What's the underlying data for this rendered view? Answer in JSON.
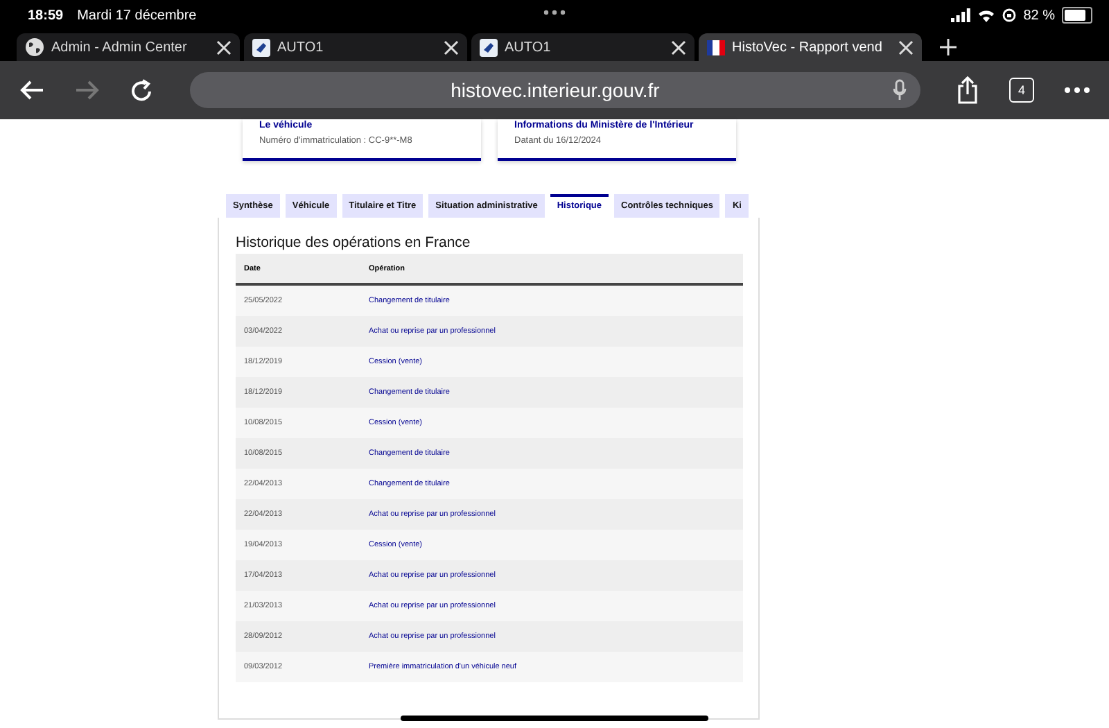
{
  "status_bar": {
    "time": "18:59",
    "date": "Mardi 17 décembre",
    "battery": "82 %"
  },
  "browser_tabs": [
    {
      "title": "Admin - Admin Center",
      "selected": false
    },
    {
      "title": "AUTO1",
      "selected": false
    },
    {
      "title": "AUTO1",
      "selected": false
    },
    {
      "title": "HistoVec - Rapport vend",
      "selected": true
    }
  ],
  "toolbar": {
    "url": "histovec.interieur.gouv.fr",
    "tab_count": "4"
  },
  "cards": [
    {
      "title": "Le véhicule",
      "text": "Numéro d'immatriculation : CC-9**-M8"
    },
    {
      "title": "Informations du Ministère de l'Intérieur",
      "text": "Datant du 16/12/2024"
    }
  ],
  "tabs": [
    {
      "label": "Synthèse",
      "selected": false
    },
    {
      "label": "Véhicule",
      "selected": false
    },
    {
      "label": "Titulaire et Titre",
      "selected": false
    },
    {
      "label": "Situation administrative",
      "selected": false
    },
    {
      "label": "Historique",
      "selected": true
    },
    {
      "label": "Contrôles techniques",
      "selected": false
    },
    {
      "label": "Ki",
      "selected": false
    }
  ],
  "section_title": "Historique des opérations en France",
  "table": {
    "columns": [
      "Date",
      "Opération"
    ],
    "rows": [
      {
        "date": "25/05/2022",
        "operation": "Changement de titulaire"
      },
      {
        "date": "03/04/2022",
        "operation": "Achat ou reprise par un professionnel"
      },
      {
        "date": "18/12/2019",
        "operation": "Cession (vente)"
      },
      {
        "date": "18/12/2019",
        "operation": "Changement de titulaire"
      },
      {
        "date": "10/08/2015",
        "operation": "Cession (vente)"
      },
      {
        "date": "10/08/2015",
        "operation": "Changement de titulaire"
      },
      {
        "date": "22/04/2013",
        "operation": "Changement de titulaire"
      },
      {
        "date": "22/04/2013",
        "operation": "Achat ou reprise par un professionnel"
      },
      {
        "date": "19/04/2013",
        "operation": "Cession (vente)"
      },
      {
        "date": "17/04/2013",
        "operation": "Achat ou reprise par un professionnel"
      },
      {
        "date": "21/03/2013",
        "operation": "Achat ou reprise par un professionnel"
      },
      {
        "date": "28/09/2012",
        "operation": "Achat ou reprise par un professionnel"
      },
      {
        "date": "09/03/2012",
        "operation": "Première immatriculation d'un véhicule neuf"
      }
    ]
  }
}
